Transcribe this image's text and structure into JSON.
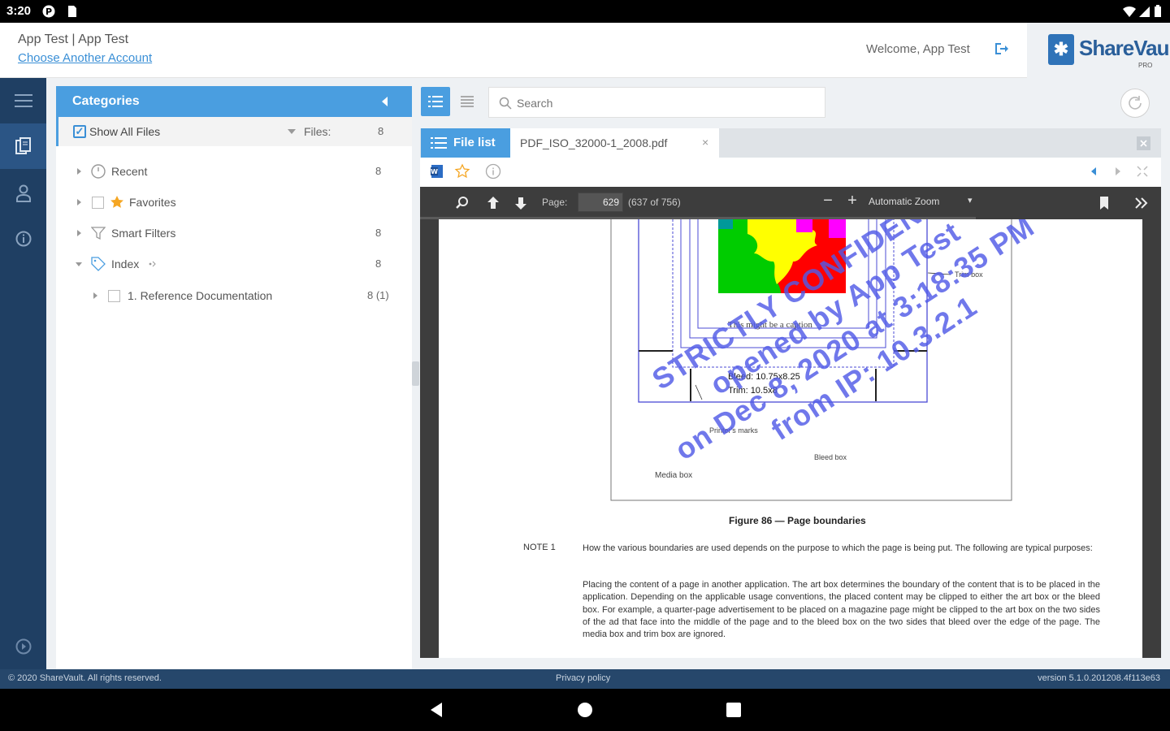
{
  "status_bar": {
    "time": "3:20"
  },
  "header": {
    "account_name": "App Test | App Test",
    "choose_account": "Choose Another Account",
    "welcome": "Welcome, App Test",
    "logo_text": "ShareVault",
    "logo_sub": "PRO"
  },
  "rail": {
    "items": [
      "menu-icon",
      "documents-icon",
      "user-icon",
      "help-icon",
      "play-icon"
    ]
  },
  "categories": {
    "title": "Categories",
    "show_all": {
      "label": "Show All Files",
      "files_label": "Files:",
      "count": "8",
      "checked": true
    },
    "items": [
      {
        "label": "Recent",
        "count": "8",
        "icon": "clock-icon"
      },
      {
        "label": "Favorites",
        "count": "",
        "icon": "star-icon"
      },
      {
        "label": "Smart Filters",
        "count": "8",
        "icon": "filter-icon"
      },
      {
        "label": "Index",
        "count": "8",
        "icon": "tag-icon"
      },
      {
        "label": "1. Reference Documentation",
        "count": "8 (1)",
        "icon": "folder"
      }
    ]
  },
  "search": {
    "placeholder": "Search"
  },
  "tabs": {
    "file_list": "File list",
    "document": "PDF_ISO_32000-1_2008.pdf",
    "close": "×"
  },
  "pdf_viewer": {
    "page_label": "Page:",
    "page_value": "629",
    "page_total": "(637 of 756)",
    "zoom_minus": "−",
    "zoom_plus": "+",
    "zoom": "Automatic Zoom"
  },
  "document": {
    "fig_trim_box": "Trim box",
    "fig_caption_inner": "This might be a caption",
    "fig_bleed": "Bleed: 10.75x8.25",
    "fig_trim": "Trim: 10.5x8",
    "fig_printers_marks": "Printer's marks",
    "fig_bleed_box": "Bleed box",
    "fig_media_box": "Media box",
    "figure_caption": "Figure 86 — Page boundaries",
    "note_label": "NOTE 1",
    "note_text": "How the various boundaries are used depends on the purpose to which the page is being put. The following are typical purposes:",
    "note_text2": "Placing the content of a page in another application. The art box determines the boundary of the content that is to be placed in the application. Depending on the applicable usage conventions, the placed content may be clipped to either the art box or the bleed box. For example, a quarter-page advertisement to be placed on a magazine page might be clipped to the art box on the two sides of the ad that face into the middle of the page and to the bleed box on the two sides that bleed over the edge of the page. The media box and trim box are ignored.",
    "watermark_lines": [
      "STRICTLY CONFIDENTIAL",
      "opened by App Test",
      "on Dec 8, 2020 at 3:18:35 PM",
      "from IP: 10.3.2.1"
    ]
  },
  "footer": {
    "copyright": "© 2020 ShareVault. All rights reserved.",
    "privacy": "Privacy policy",
    "version": "version 5.1.0.201208.4f113e63"
  },
  "colors": {
    "accent": "#4a9ee0",
    "rail": "#1f3f63",
    "footer": "#26476b",
    "watermark": "#5a5ae6"
  }
}
